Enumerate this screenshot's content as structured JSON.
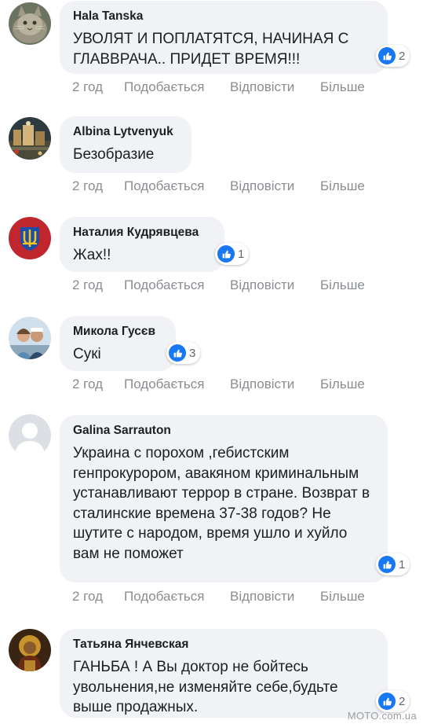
{
  "actions": {
    "time": "2 год",
    "like": "Подобається",
    "reply": "Відповісти",
    "more": "Більше"
  },
  "comments": [
    {
      "author": "Hala Tanska",
      "text": "УВОЛЯТ И ПОПЛАТЯТСЯ, НАЧИНАЯ С ГЛАВВРАЧА.. ПРИДЕТ ВРЕМЯ!!!",
      "reactions": "2",
      "avatar_icon": "cat-photo"
    },
    {
      "author": "Albina Lytvenyuk",
      "text": "Безобразие",
      "reactions": "",
      "avatar_icon": "city-photo"
    },
    {
      "author": "Наталия Кудрявцева",
      "text": "Жах!!",
      "reactions": "1",
      "avatar_icon": "trident-emblem"
    },
    {
      "author": "Микола Гусєв",
      "text": "Сукі",
      "reactions": "3",
      "avatar_icon": "couple-photo"
    },
    {
      "author": "Galina Sarrauton",
      "text": "Украина с порохом ,гебистским генпрокурором, авакяном криминальным устанавливают террор в стране. Возврат в сталинские времена 37-38 годов? Не шутите с народом, время ушло и хуйло вам не поможет",
      "reactions": "1",
      "avatar_icon": "default-user-silhouette"
    },
    {
      "author": "Татьяна Янчевская",
      "text": "ГАНЬБА ! А Вы доктор не бойтесь увольнения,не изменяйте себе,будьте выше продажных.",
      "reactions": "2",
      "avatar_icon": "icon-portrait"
    }
  ],
  "watermark": "MOTO.com.ua",
  "colors": {
    "bubble": "#f0f2f5",
    "like_blue": "#1877f2",
    "action_gray": "#8a8d91"
  }
}
